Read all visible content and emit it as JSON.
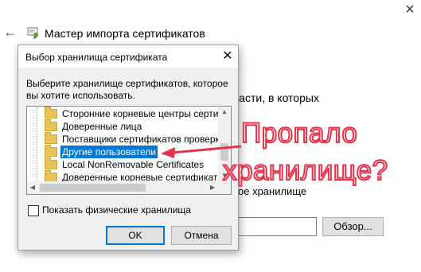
{
  "wizard": {
    "title": "Мастер импорта сертификатов",
    "partial_line_1": "ласти, в которых",
    "partial_line_2": "ое хранилище",
    "browse_button": "Обзор...",
    "back_icon": "back-arrow-icon",
    "close_icon": "close-icon"
  },
  "dialog": {
    "title": "Выбор хранилища сертификата",
    "instruction": "Выберите хранилище сертификатов, которое вы хотите использовать.",
    "tree_items": [
      {
        "label": "Сторонние корневые центры сертифи",
        "selected": false
      },
      {
        "label": "Доверенные лица",
        "selected": false
      },
      {
        "label": "Поставщики сертификатов проверки г",
        "selected": false
      },
      {
        "label": "Другие пользователи",
        "selected": true
      },
      {
        "label": "Local NonRemovable Certificates",
        "selected": false
      },
      {
        "label": "Доверенные корневые сертификаты",
        "selected": false
      }
    ],
    "show_physical_label": "Показать физические хранилища",
    "show_physical_checked": false,
    "ok_label": "OK",
    "cancel_label": "Отмена"
  },
  "annotation": {
    "line1": "Пропало",
    "line2": "хранилище?",
    "color": "#e8324a"
  }
}
